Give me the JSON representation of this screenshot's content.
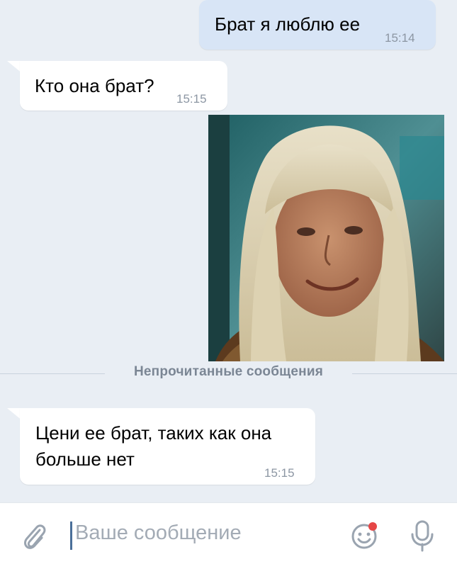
{
  "messages": [
    {
      "direction": "out",
      "text": "Брат я люблю ее",
      "time": "15:14"
    },
    {
      "direction": "in",
      "text": "Кто она брат?",
      "time": "15:15"
    },
    {
      "direction": "out",
      "type": "photo"
    },
    {
      "direction": "in",
      "text_line1": "Цени ее брат, таких как она",
      "text_line2": "больше нет",
      "time": "15:15"
    }
  ],
  "unread_divider": "Непрочитанные сообщения",
  "composer": {
    "placeholder": "Ваше сообщение",
    "icons": [
      "paperclip-icon",
      "emoji-icon",
      "microphone-icon"
    ],
    "notification_dot_color": "#e64646"
  },
  "colors": {
    "chat_background": "#e9eef4",
    "outgoing_bubble": "#d8e5f6",
    "incoming_bubble": "#ffffff",
    "accent": "#4a6f99"
  }
}
